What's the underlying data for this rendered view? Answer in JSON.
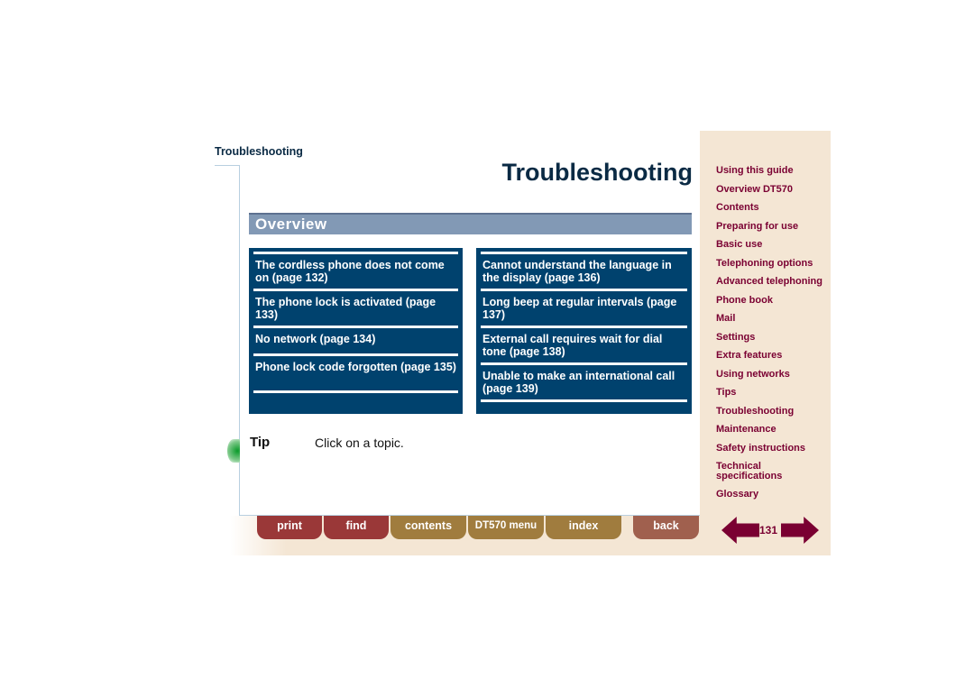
{
  "breadcrumb": "Troubleshooting",
  "title": "Troubleshooting",
  "section": "Overview",
  "left_topics": [
    "The cordless phone does not come on (page 132)",
    "The phone lock is activated (page 133)",
    "No network (page 134)",
    "Phone lock code forgotten (page 135)"
  ],
  "right_topics": [
    "Cannot understand the language in the display (page 136)",
    "Long beep at regular intervals (page 137)",
    "External call requires wait for dial tone (page 138)",
    "Unable to make an international call (page 139)"
  ],
  "tip": {
    "label": "Tip",
    "text": "Click on a topic."
  },
  "nav": [
    "print",
    "find",
    "contents",
    "DT570 menu",
    "index",
    "back"
  ],
  "sidebar": [
    "Using this guide",
    "Overview DT570",
    "Contents",
    "Preparing for use",
    "Basic use",
    "Telephoning options",
    "Advanced telephoning",
    "Phone book",
    "Mail",
    "Settings",
    "Extra features",
    "Using networks",
    "Tips",
    "Troubleshooting",
    "Maintenance",
    "Safety instructions",
    "Technical specifications",
    "Glossary"
  ],
  "page_number": "131",
  "colors": {
    "box": "#00426e",
    "overview": "#8299b5",
    "sidebar": "#f4e6d4",
    "link": "#7a0032"
  }
}
